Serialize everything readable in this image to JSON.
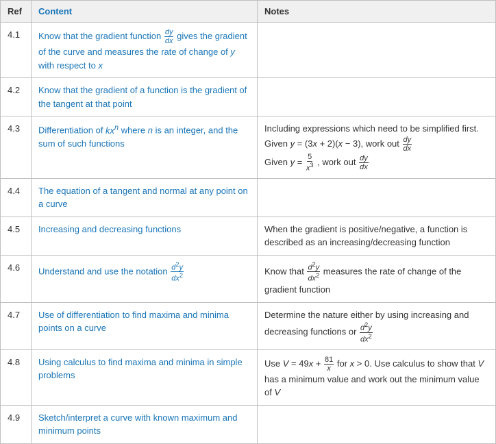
{
  "table": {
    "headers": {
      "ref": "Ref",
      "content": "Content",
      "notes": "Notes"
    },
    "rows": [
      {
        "ref": "4.1",
        "content_text": "Know that the gradient function dy/dx gives the gradient of the curve and measures the rate of change of y with respect to x",
        "notes_text": ""
      },
      {
        "ref": "4.2",
        "content_text": "Know that the gradient of a function is the gradient of the tangent at that point",
        "notes_text": ""
      },
      {
        "ref": "4.3",
        "content_text": "Differentiation of kxⁿ where n is an integer, and the sum of such functions",
        "notes_text": "Including expressions which need to be simplified first. Given y = (3x + 2)(x − 3), work out dy/dx. Given y = 5/x³, work out dy/dx"
      },
      {
        "ref": "4.4",
        "content_text": "The equation of a tangent and normal at any point on a curve",
        "notes_text": ""
      },
      {
        "ref": "4.5",
        "content_text": "Increasing and decreasing functions",
        "notes_text": "When the gradient is positive/negative, a function is described as an increasing/decreasing function"
      },
      {
        "ref": "4.6",
        "content_text": "Understand and use the notation d²y/dx²",
        "notes_text": "Know that d²y/dx² measures the rate of change of the gradient function"
      },
      {
        "ref": "4.7",
        "content_text": "Use of differentiation to find maxima and minima points on a curve",
        "notes_text": "Determine the nature either by using increasing and decreasing functions or d²y/dx²"
      },
      {
        "ref": "4.8",
        "content_text": "Using calculus to find maxima and minima in simple problems",
        "notes_text": "Use V = 49x + 81/x for x > 0. Use calculus to show that V has a minimum value and work out the minimum value of V"
      },
      {
        "ref": "4.9",
        "content_text": "Sketch/interpret a curve with known maximum and minimum points",
        "notes_text": ""
      }
    ]
  }
}
